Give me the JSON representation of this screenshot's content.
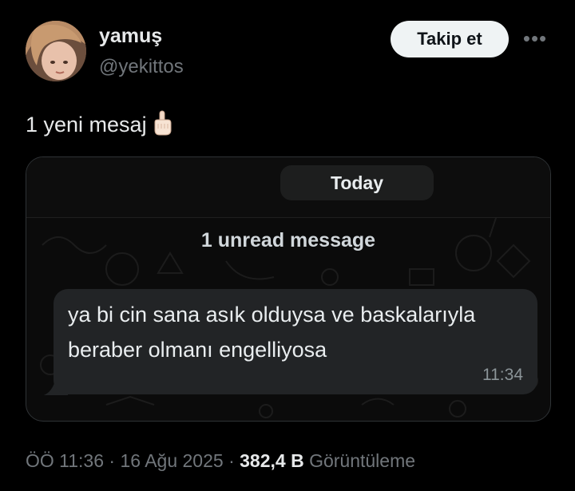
{
  "author": {
    "display_name": "yamuş",
    "handle": "@yekittos"
  },
  "actions": {
    "follow_label": "Takip et",
    "more_label": "•••"
  },
  "tweet": {
    "text": "1 yeni mesaj"
  },
  "chat_screenshot": {
    "date_label": "Today",
    "unread_label": "1 unread message",
    "message_text": "ya bi cin sana asık olduysa ve baskalarıyla beraber olmanı engelliyosa",
    "message_time": "11:34"
  },
  "meta": {
    "time": "ÖÖ 11:36",
    "separator": "·",
    "date": "16 Ağu 2025",
    "views_count": "382,4 B",
    "views_label": "Görüntüleme"
  },
  "colors": {
    "background": "#000000",
    "primary_text": "#e7e9ea",
    "secondary_text": "#71767b",
    "follow_button_bg": "#eff3f4",
    "bubble_bg": "#222426"
  }
}
